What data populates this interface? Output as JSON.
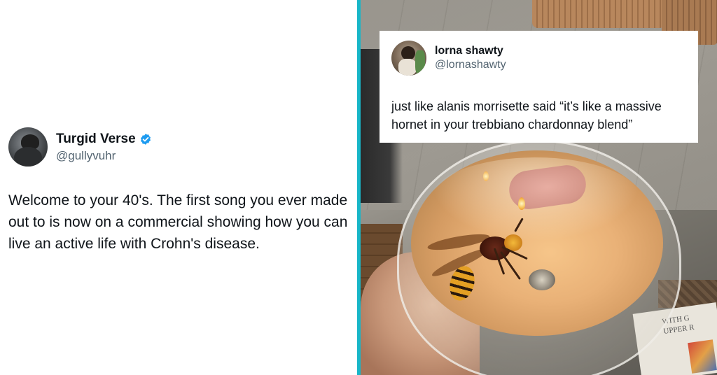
{
  "left_tweet": {
    "display_name": "Turgid Verse",
    "handle": "@gullyvuhr",
    "verified": true,
    "verified_icon": "verified-badge-icon",
    "body": "Welcome to your 40's. The first song you ever made out to is now on a commercial showing how you can live an active life with Crohn's disease."
  },
  "right_tweet": {
    "display_name": "lorna shawty",
    "handle": "@lornashawty",
    "body": "just like alanis morrisette said “it’s like a massive hornet in your trebbiano chardonnay blend”"
  },
  "photo": {
    "description_icon": "hornet-in-wine-glass-photo",
    "newspaper_text": "WITH G\nUPPER R"
  },
  "colors": {
    "divider": "#18b6c8",
    "verified": "#1d9bf0",
    "text_primary": "#0f1419",
    "text_secondary": "#536471"
  }
}
